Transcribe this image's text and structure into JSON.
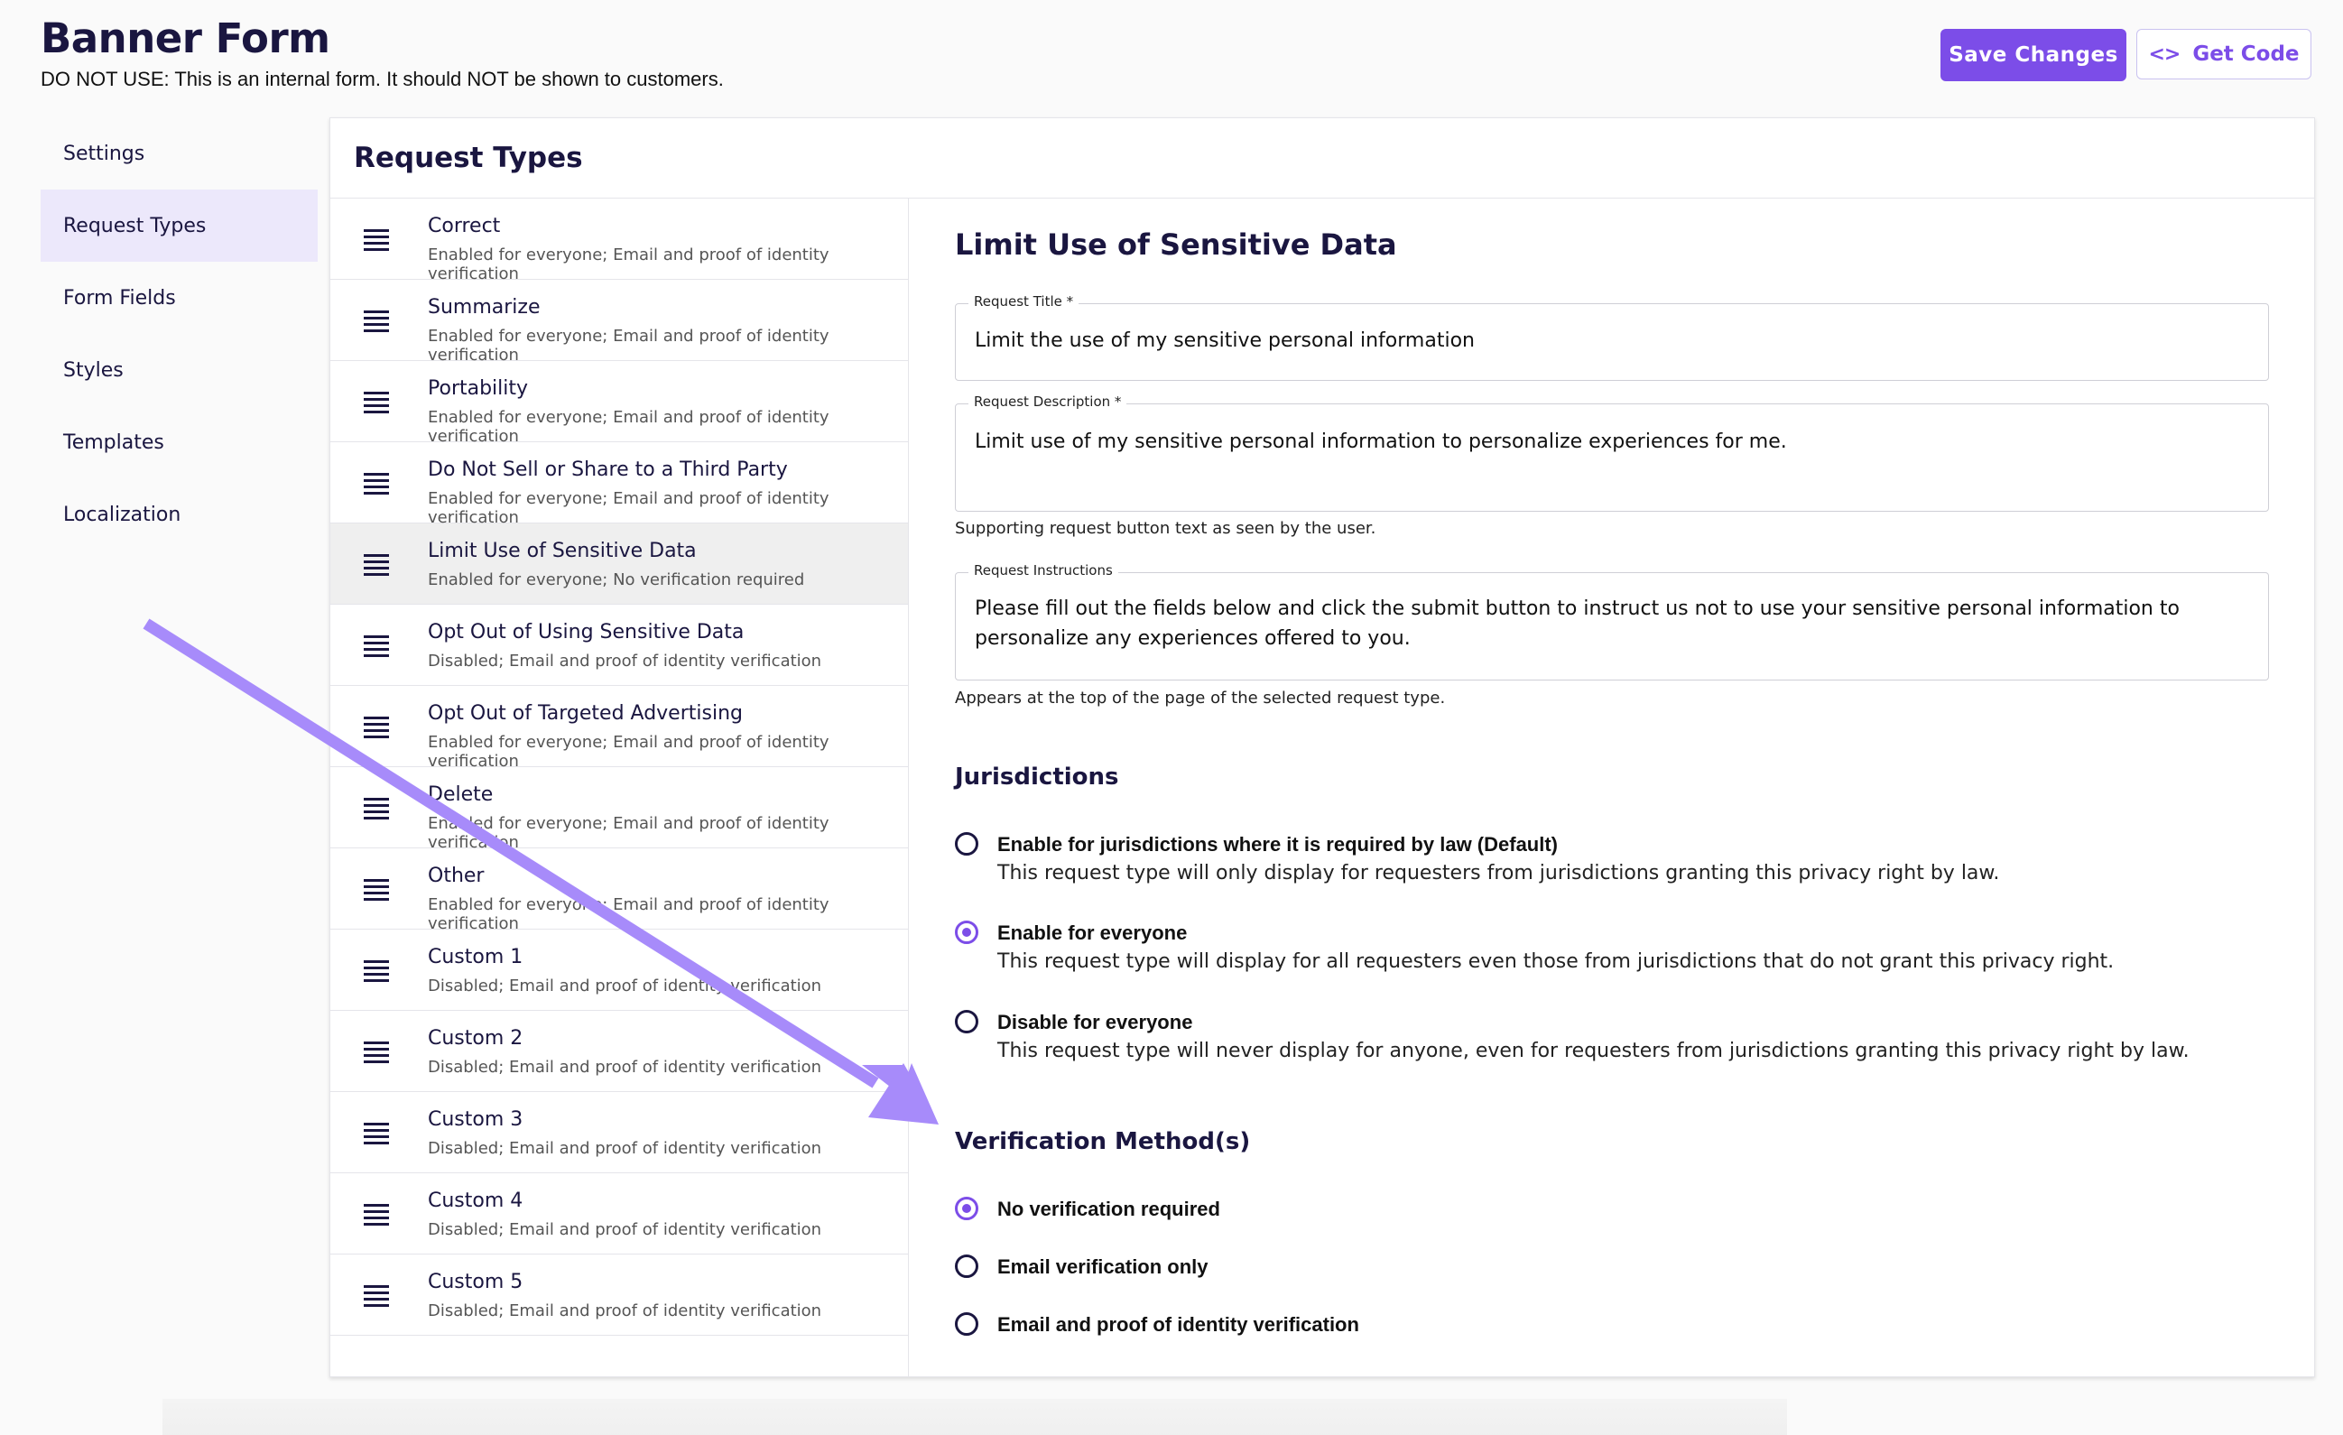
{
  "header": {
    "title": "Banner Form",
    "subtitle": "DO NOT USE: This is an internal form. It should NOT be shown to customers.",
    "save_label": "Save Changes",
    "code_icon": "<>",
    "code_label": "Get Code"
  },
  "sidenav": {
    "items": [
      {
        "label": "Settings"
      },
      {
        "label": "Request Types"
      },
      {
        "label": "Form Fields"
      },
      {
        "label": "Styles"
      },
      {
        "label": "Templates"
      },
      {
        "label": "Localization"
      }
    ],
    "active_index": 1
  },
  "card": {
    "title": "Request Types"
  },
  "request_types": [
    {
      "title": "Correct",
      "status": "Enabled for everyone; Email and proof of identity verification"
    },
    {
      "title": "Summarize",
      "status": "Enabled for everyone; Email and proof of identity verification"
    },
    {
      "title": "Portability",
      "status": "Enabled for everyone; Email and proof of identity verification"
    },
    {
      "title": "Do Not Sell or Share to a Third Party",
      "status": "Enabled for everyone; Email and proof of identity verification"
    },
    {
      "title": "Limit Use of Sensitive Data",
      "status": "Enabled for everyone; No verification required"
    },
    {
      "title": "Opt Out of Using Sensitive Data",
      "status": "Disabled; Email and proof of identity verification"
    },
    {
      "title": "Opt Out of Targeted Advertising",
      "status": "Enabled for everyone; Email and proof of identity verification"
    },
    {
      "title": "Delete",
      "status": "Enabled for everyone; Email and proof of identity verification"
    },
    {
      "title": "Other",
      "status": "Enabled for everyone; Email and proof of identity verification"
    },
    {
      "title": "Custom 1",
      "status": "Disabled; Email and proof of identity verification"
    },
    {
      "title": "Custom 2",
      "status": "Disabled; Email and proof of identity verification"
    },
    {
      "title": "Custom 3",
      "status": "Disabled; Email and proof of identity verification"
    },
    {
      "title": "Custom 4",
      "status": "Disabled; Email and proof of identity verification"
    },
    {
      "title": "Custom 5",
      "status": "Disabled; Email and proof of identity verification"
    }
  ],
  "selected_index": 4,
  "detail": {
    "title": "Limit Use of Sensitive Data",
    "request_title": {
      "label": "Request Title *",
      "value": "Limit the use of my sensitive personal information"
    },
    "request_description": {
      "label": "Request Description *",
      "value": "Limit use of my sensitive personal information to personalize experiences for me.",
      "helper": "Supporting request button text as seen by the user."
    },
    "request_instructions": {
      "label": "Request Instructions",
      "value": "Please fill out the fields below and click the submit button to instruct us not to use your sensitive personal information to personalize any experiences offered to you.",
      "helper": "Appears at the top of the page of the selected request type."
    },
    "jurisdictions": {
      "heading": "Jurisdictions",
      "options": [
        {
          "label": "Enable for jurisdictions where it is required by law (Default)",
          "desc": "This request type will only display for requesters from jurisdictions granting this privacy right by law.",
          "checked": false
        },
        {
          "label": "Enable for everyone",
          "desc": "This request type will display for all requesters even those from jurisdictions that do not grant this privacy right.",
          "checked": true
        },
        {
          "label": "Disable for everyone",
          "desc": "This request type will never display for anyone, even for requesters from jurisdictions granting this privacy right by law.",
          "checked": false
        }
      ]
    },
    "verification": {
      "heading": "Verification Method(s)",
      "options": [
        {
          "label": "No verification required",
          "checked": true
        },
        {
          "label": "Email verification only",
          "checked": false
        },
        {
          "label": "Email and proof of identity verification",
          "checked": false
        }
      ]
    }
  },
  "colors": {
    "accent": "#7c4de8",
    "arrow": "#a78bfa",
    "text": "#1a1640"
  }
}
